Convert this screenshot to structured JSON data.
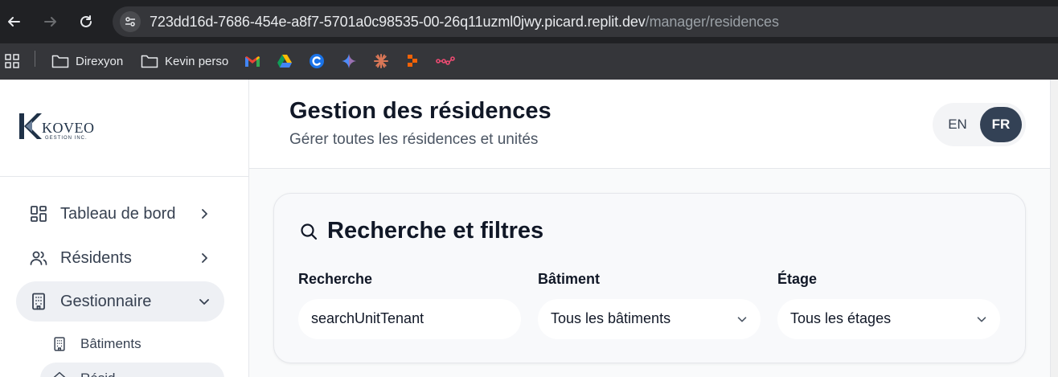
{
  "browser": {
    "url_host": "723dd16d-7686-454e-a8f7-5701a0c98535-00-26q11uzml0jwy.picard.replit.dev",
    "url_path": "/manager/residences",
    "bookmarks": [
      {
        "label": "Direxyon",
        "icon": "folder-icon"
      },
      {
        "label": "Kevin perso",
        "icon": "folder-icon"
      }
    ],
    "bookmark_icons": [
      "gmail-icon",
      "google-drive-icon",
      "c-app-icon",
      "gemini-icon",
      "claude-icon",
      "replit-icon",
      "n8n-icon"
    ]
  },
  "sidebar": {
    "logo_text": "KOVEO",
    "logo_tagline": "GESTION INC.",
    "items": [
      {
        "label": "Tableau de bord",
        "icon": "dashboard-icon"
      },
      {
        "label": "Résidents",
        "icon": "users-icon"
      },
      {
        "label": "Gestionnaire",
        "icon": "building-icon"
      }
    ],
    "sub_items": [
      {
        "label": "Bâtiments",
        "icon": "building-icon"
      },
      {
        "label": "Résid",
        "icon": "home-icon"
      }
    ]
  },
  "header": {
    "title": "Gestion des résidences",
    "subtitle": "Gérer toutes les résidences et unités",
    "lang_en": "EN",
    "lang_fr": "FR"
  },
  "filters": {
    "title": "Recherche et filtres",
    "search_label": "Recherche",
    "search_value": "searchUnitTenant",
    "building_label": "Bâtiment",
    "building_value": "Tous les bâtiments",
    "floor_label": "Étage",
    "floor_value": "Tous les étages"
  },
  "colors": {
    "accent": "#334155",
    "chrome_dark": "#202124",
    "chrome_bar": "#35363a"
  }
}
